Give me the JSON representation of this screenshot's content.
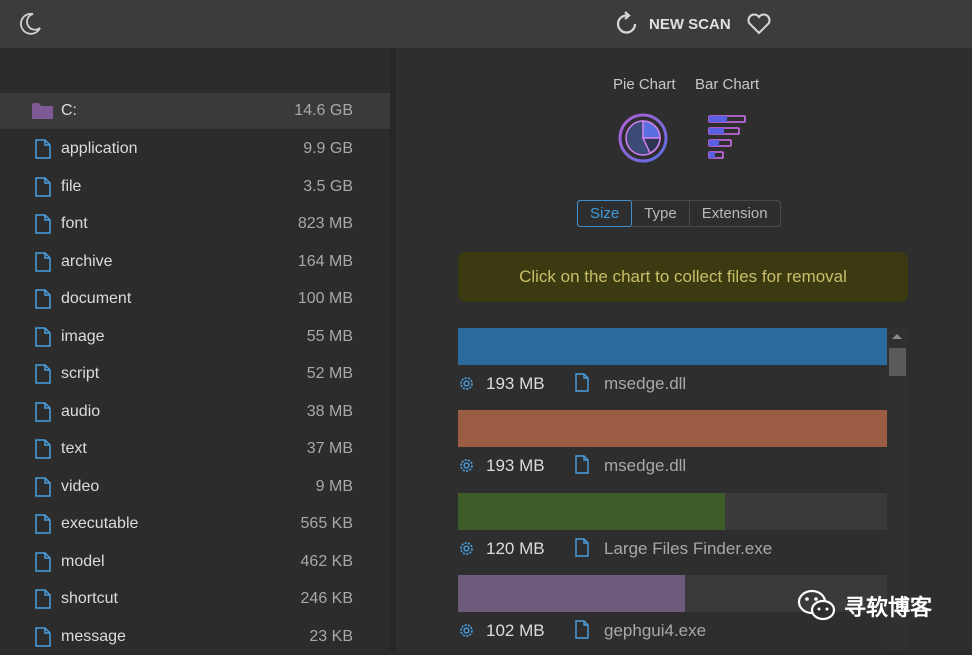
{
  "topbar": {
    "theme_icon": "moon-icon",
    "scan_icon": "refresh-icon",
    "scan_label": "NEW SCAN",
    "favorite_icon": "heart-icon"
  },
  "tree": {
    "root": {
      "name": "C:",
      "size": "14.6 GB",
      "icon": "folder-icon"
    },
    "items": [
      {
        "name": "application",
        "size": "9.9 GB"
      },
      {
        "name": "file",
        "size": "3.5 GB"
      },
      {
        "name": "font",
        "size": "823 MB"
      },
      {
        "name": "archive",
        "size": "164 MB"
      },
      {
        "name": "document",
        "size": "100 MB"
      },
      {
        "name": "image",
        "size": "55 MB"
      },
      {
        "name": "script",
        "size": "52 MB"
      },
      {
        "name": "audio",
        "size": "38 MB"
      },
      {
        "name": "text",
        "size": "37 MB"
      },
      {
        "name": "video",
        "size": "9 MB"
      },
      {
        "name": "executable",
        "size": "565 KB"
      },
      {
        "name": "model",
        "size": "462 KB"
      },
      {
        "name": "shortcut",
        "size": "246 KB"
      },
      {
        "name": "message",
        "size": "23 KB"
      }
    ]
  },
  "main": {
    "pie_label": "Pie Chart",
    "bar_label": "Bar Chart",
    "tabs": [
      {
        "label": "Size",
        "active": true
      },
      {
        "label": "Type",
        "active": false
      },
      {
        "label": "Extension",
        "active": false
      }
    ],
    "notice": "Click on the chart to collect files for removal",
    "files": [
      {
        "size": "193 MB",
        "name": "msedge.dll",
        "fill": 1.0,
        "color": "#2d6a9c"
      },
      {
        "size": "193 MB",
        "name": "msedge.dll",
        "fill": 1.0,
        "color": "#9a5c42"
      },
      {
        "size": "120 MB",
        "name": "Large Files Finder.exe",
        "fill": 0.622,
        "color": "#3e5c2a"
      },
      {
        "size": "102 MB",
        "name": "gephgui4.exe",
        "fill": 0.528,
        "color": "#6e5a7a"
      }
    ]
  },
  "watermark": {
    "text": "寻软博客",
    "icon": "wechat-icon"
  }
}
